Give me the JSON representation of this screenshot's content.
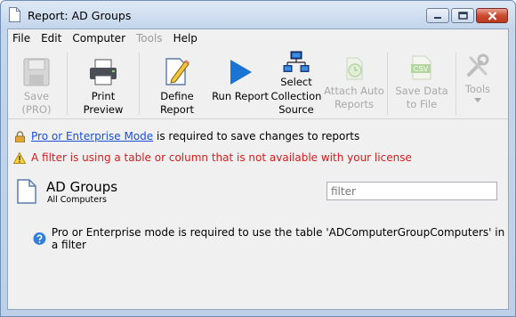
{
  "window": {
    "title": "Report: AD Groups"
  },
  "menu": [
    {
      "label": "File",
      "enabled": true
    },
    {
      "label": "Edit",
      "enabled": true
    },
    {
      "label": "Computer",
      "enabled": true
    },
    {
      "label": "Tools",
      "enabled": false
    },
    {
      "label": "Help",
      "enabled": true
    }
  ],
  "toolbar": {
    "save": "Save (PRO)",
    "print_preview": "Print Preview",
    "define_report": "Define Report",
    "run_report": "Run Report",
    "select_collection": "Select Collection Source",
    "attach_auto": "Attach Auto Reports",
    "save_data": "Save Data to File",
    "tools": "Tools",
    "csv_badge": "CSV"
  },
  "messages": {
    "mode_link": "Pro or Enterprise Mode",
    "mode_text": " is required to save changes to reports",
    "filter_warning": "A filter is using a table or column that is not available with your license"
  },
  "report": {
    "title": "AD Groups",
    "subtitle": "All Computers",
    "filter_placeholder": "filter",
    "info": "Pro or Enterprise mode is required to use the table 'ADComputerGroupComputers' in a filter"
  },
  "colors": {
    "accent_blue": "#1a6fd6",
    "warning_red": "#d21e1e",
    "link": "#1a4fd6"
  }
}
